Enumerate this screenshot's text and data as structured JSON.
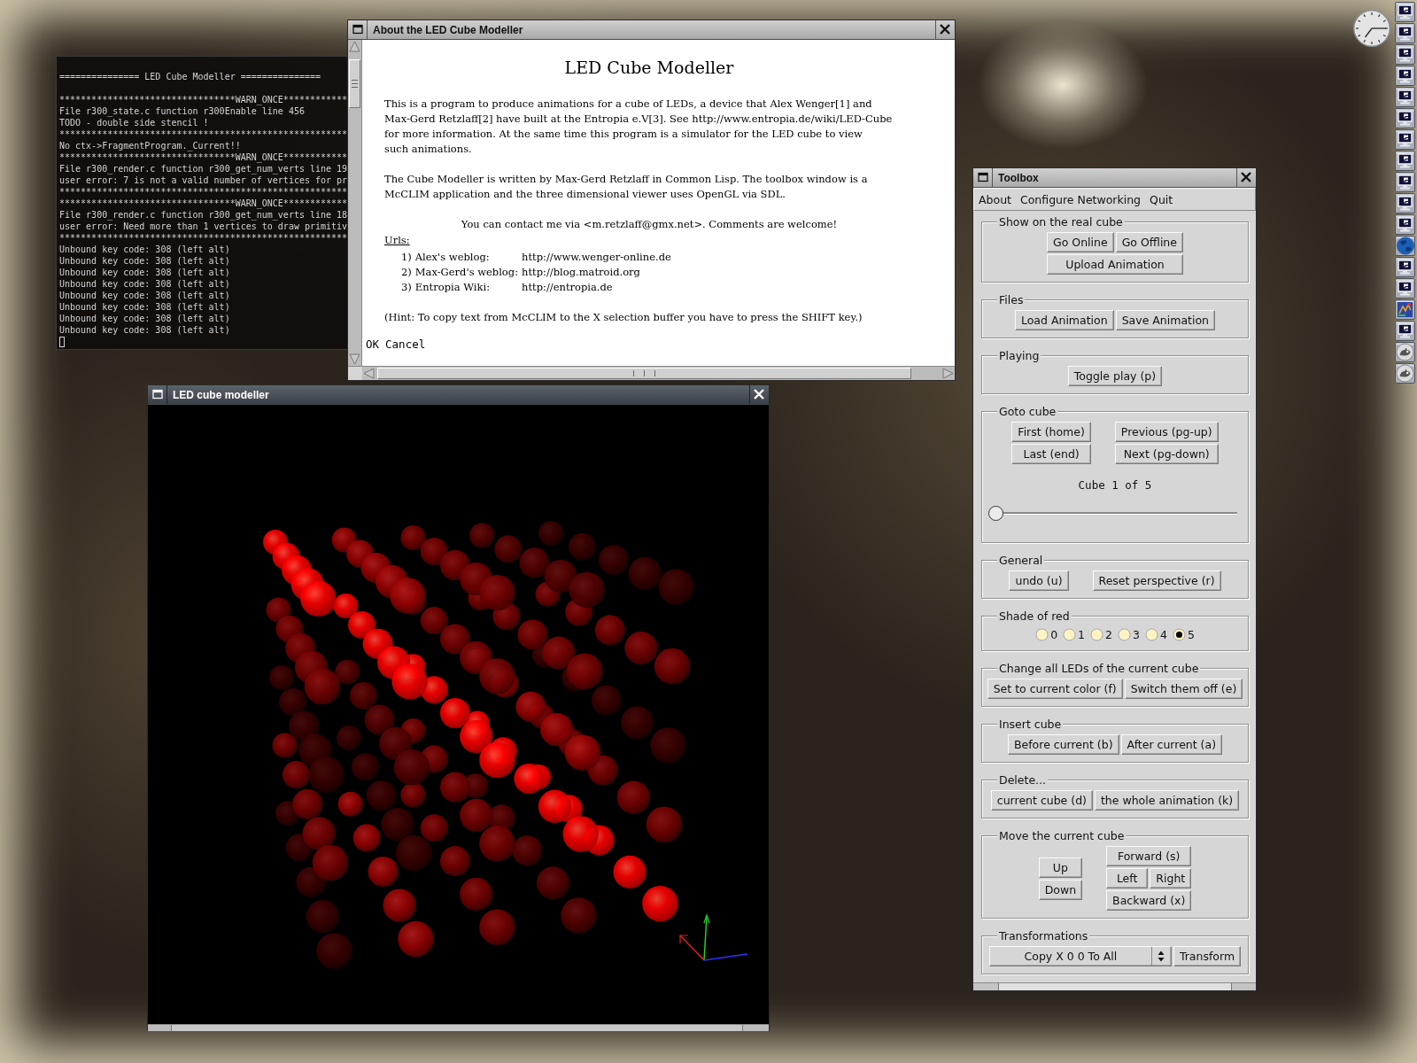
{
  "terminal": {
    "output": "=============== LED Cube Modeller ===============\n\n*********************************WARN_ONCE************\nFile r300_state.c function r300Enable line 456\nTODO - double side stencil !\n******************************************************\nNo ctx->FragmentProgram._Current!!\n*********************************WARN_ONCE************\nFile r300_render.c function r300_get_num_verts line 19\nuser error: 7 is not a valid number of vertices for pr\n******************************************************\n*********************************WARN_ONCE************\nFile r300_render.c function r300_get_num_verts line 18\nuser error: Need more than 1 vertices to draw primitiv\n******************************************************\nUnbound key code: 308 (left alt)\nUnbound key code: 308 (left alt)\nUnbound key code: 308 (left alt)\nUnbound key code: 308 (left alt)\nUnbound key code: 308 (left alt)\nUnbound key code: 308 (left alt)\nUnbound key code: 308 (left alt)\nUnbound key code: 308 (left alt)"
  },
  "about_window": {
    "title": "About the LED Cube Modeller",
    "active": false,
    "heading": "LED Cube Modeller",
    "paragraphs": [
      {
        "lines": [
          "This is a program to produce animations for a cube of LEDs, a device that Alex Wenger[1] and",
          "Max-Gerd Retzlaff[2] have built at the Entropia e.V[3]. See http://www.entropia.de/wiki/LED-Cube",
          "for more information. At the same time this program is a simulator for the LED cube to view",
          "such animations."
        ]
      },
      {
        "lines": [
          "The Cube Modeller is written by Max-Gerd Retzlaff in Common Lisp. The toolbox window is a",
          "McCLIM application and the three dimensional viewer uses OpenGL via SDL."
        ]
      }
    ],
    "contact": "You can contact me via <m.retzlaff@gmx.net>. Comments are welcome!",
    "urls_label": "Urls:",
    "urls": [
      {
        "number": "1)",
        "label": "Alex's weblog:",
        "url": "http://www.wenger-online.de"
      },
      {
        "number": "2)",
        "label": "Max-Gerd's weblog:",
        "url": "http://blog.matroid.org"
      },
      {
        "number": "3)",
        "label": "Entropia Wiki:",
        "url": "http://entropia.de"
      }
    ],
    "hint": "(Hint: To copy text from McCLIM to the X selection buffer you have to press the SHIFT key.)",
    "buttons": [
      "OK",
      "Cancel"
    ]
  },
  "viewer_window": {
    "title": "LED cube modeller",
    "active": true
  },
  "toolbox": {
    "title": "Toolbox",
    "active": false,
    "menu": [
      "About",
      "Configure Networking",
      "Quit"
    ],
    "groups": [
      {
        "legend": "Show on the real cube",
        "kind": "buttons",
        "columns": [
          {
            "rows": [
              [
                "Go Online",
                "Go Offline"
              ],
              [
                "Upload Animation"
              ]
            ]
          }
        ]
      },
      {
        "legend": "Files",
        "kind": "buttons",
        "columns": [
          {
            "rows": [
              [
                "Load Animation",
                "Save Animation"
              ]
            ]
          }
        ]
      },
      {
        "legend": "Playing",
        "kind": "buttons",
        "columns": [
          {
            "rows": [
              [
                "Toggle play (p)"
              ]
            ]
          }
        ]
      },
      {
        "legend": "Goto cube",
        "kind": "navigator",
        "columns": [
          {
            "rows": [
              [
                "First (home)"
              ],
              [
                "Last (end)"
              ]
            ]
          },
          {
            "rows": [
              [
                "Previous (pg-up)"
              ],
              [
                "Next (pg-down)"
              ]
            ]
          }
        ],
        "caption": "Cube 1 of 5",
        "slider": {
          "level": 0
        }
      },
      {
        "legend": "General",
        "kind": "buttons",
        "columns": [
          {
            "rows": [
              [
                "undo (u)"
              ]
            ]
          },
          {
            "rows": [
              [
                "Reset perspective (r)"
              ]
            ]
          }
        ]
      },
      {
        "legend": "Shade of red",
        "kind": "radios",
        "options": [
          {
            "label": "0",
            "selected": false
          },
          {
            "label": "1",
            "selected": false
          },
          {
            "label": "2",
            "selected": false
          },
          {
            "label": "3",
            "selected": false
          },
          {
            "label": "4",
            "selected": false
          },
          {
            "label": "5",
            "selected": true
          }
        ]
      },
      {
        "legend": "Change all LEDs of the current cube",
        "kind": "buttons",
        "columns": [
          {
            "rows": [
              [
                "Set to current color (f)",
                "Switch them off (e)"
              ]
            ]
          }
        ]
      },
      {
        "legend": "Insert cube",
        "kind": "buttons",
        "columns": [
          {
            "rows": [
              [
                "Before current (b)",
                "After current (a)"
              ]
            ]
          }
        ]
      },
      {
        "legend": "Delete...",
        "kind": "buttons",
        "columns": [
          {
            "rows": [
              [
                "current cube (d)",
                "the whole animation (k)"
              ]
            ]
          }
        ]
      },
      {
        "legend": "Move the current cube",
        "kind": "buttons",
        "columns": [
          {
            "rows": [
              [
                "Up"
              ],
              [
                "Down"
              ]
            ]
          },
          {
            "rows": [
              [
                "Forward (s)"
              ],
              [
                "Left",
                "Right"
              ],
              [
                "Backward (x)"
              ]
            ]
          }
        ]
      },
      {
        "legend": "Transformations",
        "kind": "transform",
        "combo": {
          "value": "Copy X 0 0 To All"
        },
        "button": "Transform"
      }
    ]
  }
}
